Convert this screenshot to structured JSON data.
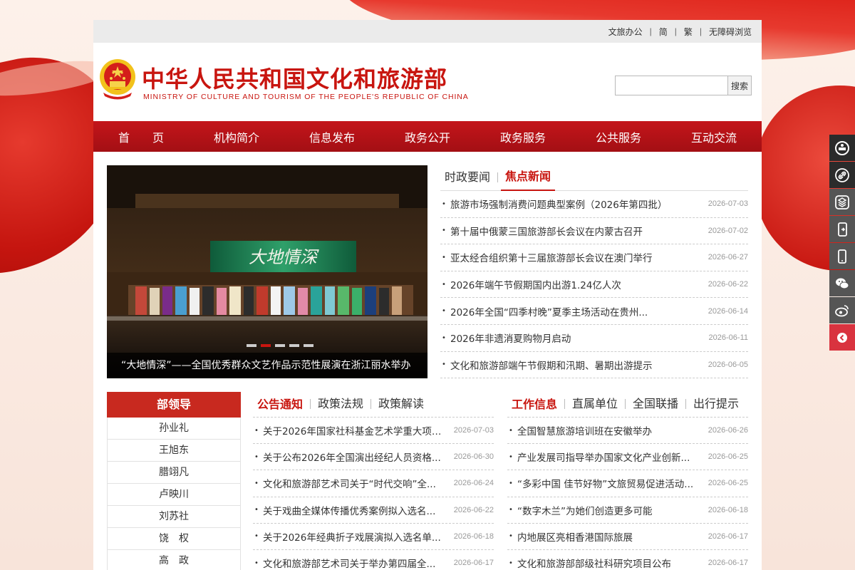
{
  "topbar": {
    "links": [
      "文旅办公",
      "简",
      "繁",
      "无障碍浏览"
    ]
  },
  "header": {
    "title_cn": "中华人民共和国文化和旅游部",
    "title_en": "MINISTRY OF CULTURE AND TOURISM OF THE PEOPLE'S REPUBLIC OF CHINA",
    "search_button": "搜索",
    "search_value": ""
  },
  "nav": {
    "items": [
      "首　　页",
      "机构简介",
      "信息发布",
      "政务公开",
      "政务服务",
      "公共服务",
      "互动交流"
    ]
  },
  "slider": {
    "banner_text": "大地情深",
    "caption": "“大地情深”——全国优秀群众文艺作品示范性展演在浙江丽水举办",
    "active_dot": 2,
    "dot_count": 5
  },
  "news": {
    "tabs": [
      "时政要闻",
      "焦点新闻"
    ],
    "active_tab": 1,
    "items": [
      {
        "title": "旅游市场强制消费问题典型案例（2026年第四批）",
        "date": "2026-07-03"
      },
      {
        "title": "第十届中俄蒙三国旅游部长会议在内蒙古召开",
        "date": "2026-07-02"
      },
      {
        "title": "亚太经合组织第十三届旅游部长会议在澳门举行",
        "date": "2026-06-27"
      },
      {
        "title": "2026年端午节假期国内出游1.24亿人次",
        "date": "2026-06-22"
      },
      {
        "title": "2026年全国“四季村晚”夏季主场活动在贵州...",
        "date": "2026-06-14"
      },
      {
        "title": "2026年非遗消夏购物月启动",
        "date": "2026-06-11"
      },
      {
        "title": "文化和旅游部端午节假期和汛期、暑期出游提示",
        "date": "2026-06-05"
      }
    ]
  },
  "leaders": {
    "title": "部领导",
    "names": [
      "孙业礼",
      "王旭东",
      "腊翊凡",
      "卢映川",
      "刘苏社",
      "饶　权",
      "高　政"
    ]
  },
  "notices": {
    "tabs": [
      "公告通知",
      "政策法规",
      "政策解读"
    ],
    "active_tab": 0,
    "items": [
      {
        "title": "关于2026年国家社科基金艺术学重大项目...",
        "date": "2026-07-03"
      },
      {
        "title": "关于公布2026年全国演出经纪人员资格...",
        "date": "2026-06-30"
      },
      {
        "title": "文化和旅游部艺术司关于“时代交响”全...",
        "date": "2026-06-24"
      },
      {
        "title": "关于戏曲全媒体传播优秀案例拟入选名...",
        "date": "2026-06-22"
      },
      {
        "title": "关于2026年经典折子戏展演拟入选名单...",
        "date": "2026-06-18"
      },
      {
        "title": "文化和旅游部艺术司关于举办第四届全...",
        "date": "2026-06-17"
      }
    ]
  },
  "work": {
    "tabs": [
      "工作信息",
      "直属单位",
      "全国联播",
      "出行提示"
    ],
    "active_tab": 0,
    "items": [
      {
        "title": "全国智慧旅游培训班在安徽举办",
        "date": "2026-06-26"
      },
      {
        "title": "产业发展司指导举办国家文化产业创新...",
        "date": "2026-06-25"
      },
      {
        "title": "“多彩中国 佳节好物”文旅贸易促进活动...",
        "date": "2026-06-25"
      },
      {
        "title": "“数字木兰”为她们创造更多可能",
        "date": "2026-06-18"
      },
      {
        "title": "内地展区亮相香港国际旅展",
        "date": "2026-06-17"
      },
      {
        "title": "文化和旅游部部级社科研究项目公布",
        "date": "2026-06-17"
      }
    ]
  },
  "float_toolbar": {
    "icons": [
      "emblem-icon",
      "link-icon",
      "app-cube-icon",
      "mobile-app-icon",
      "mobile-icon",
      "wechat-icon",
      "weibo-icon",
      "back-top-icon"
    ]
  },
  "colors": {
    "brand_red": "#c8150f",
    "nav_red": "#b3121a",
    "leader_head": "#c8291f"
  }
}
